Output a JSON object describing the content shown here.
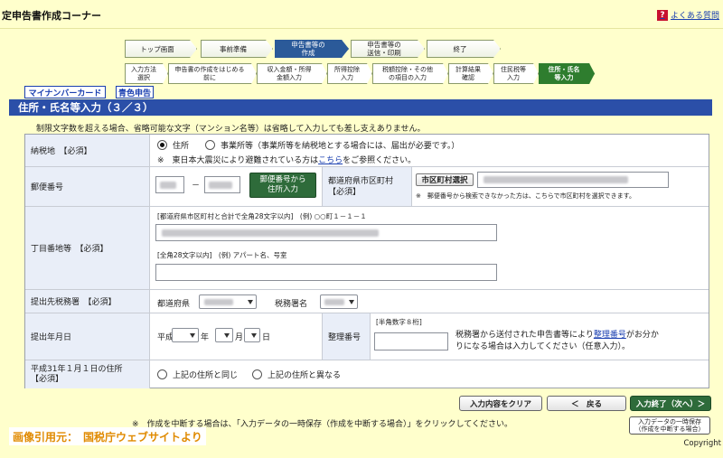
{
  "header": {
    "title": "定申告書作成コーナー",
    "faq_label": "よくある質問"
  },
  "steps": [
    "トップ画面",
    "事前準備",
    "申告書等の\n作成",
    "申告書等の\n送信・印刷",
    "終了"
  ],
  "substeps": [
    "入力方法\n選択",
    "申告書の作成をはじめる\n前に",
    "収入金額・所得\n金額入力",
    "所得控除\n入力",
    "税額控除・その他\nの項目の入力",
    "計算結果\n確認",
    "住民税等\n入力",
    "住所・氏名\n等入力"
  ],
  "tabs": {
    "mynumber": "マイナンバーカード",
    "blue": "青色申告"
  },
  "section_title": "住所・氏名等入力（３／３）",
  "notice": "制限文字数を超える場合、省略可能な文字（マンション名等）は省略して入力しても差し支えありません。",
  "rows": {
    "nouzeichi": {
      "label": "納税地　【必須】",
      "opt_address": "住所",
      "opt_office": "事業所等（事業所等を納税地とする場合には、届出が必要です。）",
      "note_prefix": "※　東日本大震災により避難されている方は",
      "note_link": "こちら",
      "note_suffix": "をご参照ください。"
    },
    "postal": {
      "label": "郵便番号",
      "dash": "－",
      "button": "郵便番号から\n住所入力",
      "pref_label": "都道府県市区町村\n【必須】",
      "city_button": "市区町村選択",
      "note": "※　郵便番号から検索できなかった方は、こちらで市区町村を選択できます。"
    },
    "chome": {
      "label": "丁目番地等　【必須】",
      "hint1": "[都道府県市区町村と合計で全角28文字以内]　(例) ○○町１－１－１",
      "hint2": "[全角28文字以内]　(例) アパート名、号室"
    },
    "office": {
      "label": "提出先税務署　【必須】",
      "pref": "都道府県",
      "tax_office": "税務署名"
    },
    "date": {
      "label": "提出年月日",
      "era": "平成",
      "year": "年",
      "month": "月",
      "day": "日",
      "seiri_label": "整理番号",
      "seiri_hint": "[半角数字８桁]",
      "seiri_note_prefix": "税務署から送付された申告書等により",
      "seiri_note_link": "整理番号",
      "seiri_note_suffix": "がお分か\nりになる場合は入力してください（任意入力）。"
    },
    "h31": {
      "label": "平成31年１月１日の住所\n【必須】",
      "same": "上記の住所と同じ",
      "diff": "上記の住所と異なる"
    }
  },
  "footer": {
    "clear": "入力内容をクリア",
    "back": "＜　戻る",
    "done": "入力終了（次へ）＞",
    "note": "※　作成を中断する場合は、「入力データの一時保存（作成を中断する場合）」をクリックしてください。",
    "save": "入力データの一時保存\n（作成を中断する場合）",
    "credit": "画像引用元：　国税庁ウェブサイトより",
    "copyright": "Copyright"
  }
}
